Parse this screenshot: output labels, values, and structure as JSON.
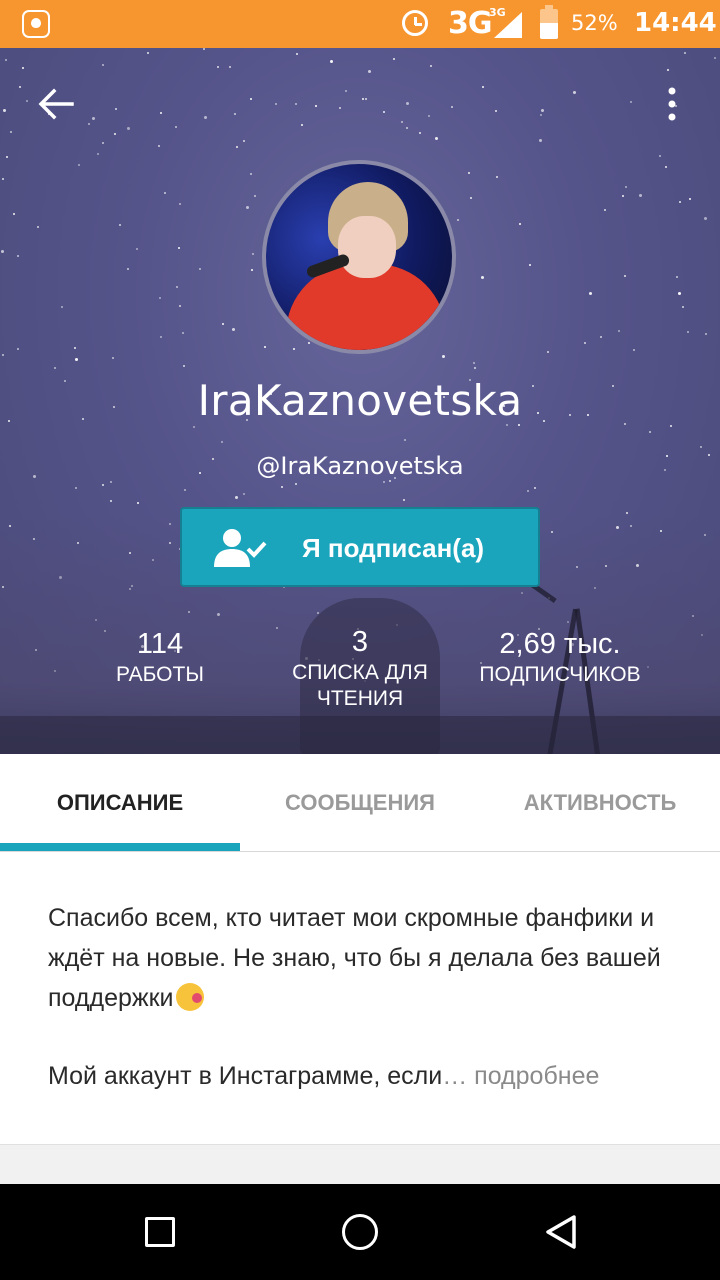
{
  "status_bar": {
    "network": "3G",
    "network_small": "3G",
    "battery": "52%",
    "time": "14:44"
  },
  "profile": {
    "display_name": "IraKaznovetska",
    "handle": "@IraKaznovetska",
    "follow_button_label": "Я подписан(а)",
    "stats": [
      {
        "value": "114",
        "label": "РАБОТЫ"
      },
      {
        "value": "3",
        "label": "СПИСКА ДЛЯ ЧТЕНИЯ"
      },
      {
        "value": "2,69 тыс.",
        "label": "ПОДПИСЧИКОВ"
      }
    ]
  },
  "tabs": [
    {
      "label": "ОПИСАНИЕ",
      "active": true
    },
    {
      "label": "СООБЩЕНИЯ",
      "active": false
    },
    {
      "label": "АКТИВНОСТЬ",
      "active": false
    }
  ],
  "description": {
    "text": "Спасибо всем, кто читает мои скромные фанфики и ждёт на новые. Не знаю, что бы я делала без вашей поддержки",
    "preview": "Мой аккаунт в Инстаграмме, если",
    "ellipsis": "…",
    "more_link": "подробнее"
  },
  "icons": {
    "back": "arrow-left-icon",
    "menu": "more-vertical-icon",
    "follow": "user-check-icon",
    "emoji": "kissing-face-emoji"
  },
  "colors": {
    "status_bar": "#f7962f",
    "accent": "#1ba5bd",
    "header_bg": "#55548a"
  }
}
